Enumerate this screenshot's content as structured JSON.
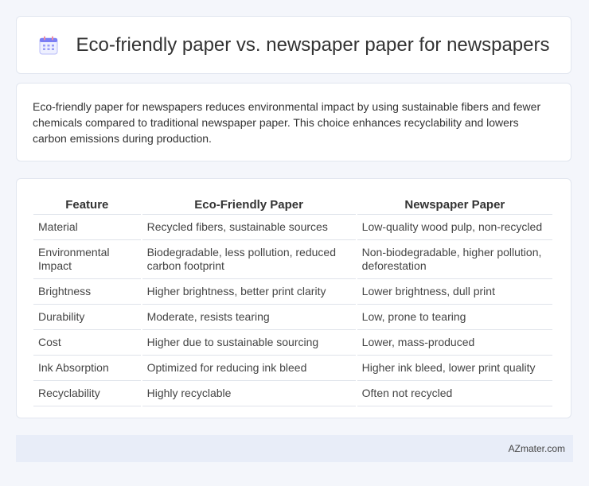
{
  "header": {
    "title": "Eco-friendly paper vs. newspaper paper for newspapers",
    "icon": "calendar-icon",
    "icon_color": "#7b7ff5"
  },
  "description": {
    "text": "Eco-friendly paper for newspapers reduces environmental impact by using sustainable fibers and fewer chemicals compared to traditional newspaper paper. This choice enhances recyclability and lowers carbon emissions during production."
  },
  "table": {
    "headers": [
      "Feature",
      "Eco-Friendly Paper",
      "Newspaper Paper"
    ],
    "rows": [
      [
        "Material",
        "Recycled fibers, sustainable sources",
        "Low-quality wood pulp, non-recycled"
      ],
      [
        "Environmental Impact",
        "Biodegradable, less pollution, reduced carbon footprint",
        "Non-biodegradable, higher pollution, deforestation"
      ],
      [
        "Brightness",
        "Higher brightness, better print clarity",
        "Lower brightness, dull print"
      ],
      [
        "Durability",
        "Moderate, resists tearing",
        "Low, prone to tearing"
      ],
      [
        "Cost",
        "Higher due to sustainable sourcing",
        "Lower, mass-produced"
      ],
      [
        "Ink Absorption",
        "Optimized for reducing ink bleed",
        "Higher ink bleed, lower print quality"
      ],
      [
        "Recyclability",
        "Highly recyclable",
        "Often not recycled"
      ]
    ]
  },
  "footer": {
    "brand": "AZmater.com"
  }
}
